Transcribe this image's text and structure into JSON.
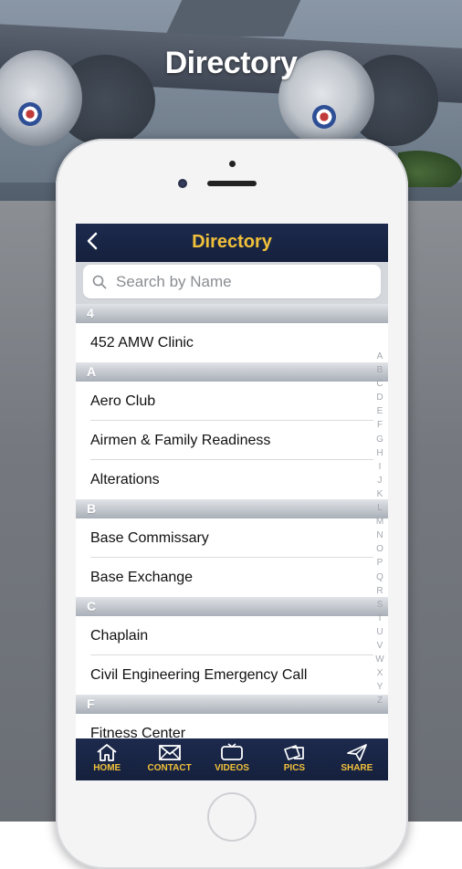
{
  "page_title": "Directory",
  "nav": {
    "back_icon": "‹",
    "title": "Directory"
  },
  "search": {
    "placeholder": "Search by Name"
  },
  "sections": [
    {
      "letter": "4",
      "items": [
        "452 AMW Clinic"
      ]
    },
    {
      "letter": "A",
      "items": [
        "Aero Club",
        "Airmen & Family Readiness",
        "Alterations"
      ]
    },
    {
      "letter": "B",
      "items": [
        "Base Commissary",
        "Base Exchange"
      ]
    },
    {
      "letter": "C",
      "items": [
        "Chaplain",
        "Civil Engineering Emergency Call"
      ]
    },
    {
      "letter": "F",
      "items": [
        "Fitness Center"
      ]
    }
  ],
  "index_letters": [
    "A",
    "B",
    "C",
    "D",
    "E",
    "F",
    "G",
    "H",
    "I",
    "J",
    "K",
    "L",
    "M",
    "N",
    "O",
    "P",
    "Q",
    "R",
    "S",
    "T",
    "U",
    "V",
    "W",
    "X",
    "Y",
    "Z"
  ],
  "tabs": [
    {
      "label": "HOME",
      "icon": "home-icon"
    },
    {
      "label": "CONTACT",
      "icon": "envelope-icon"
    },
    {
      "label": "VIDEOS",
      "icon": "tv-icon"
    },
    {
      "label": "PICS",
      "icon": "photos-icon"
    },
    {
      "label": "SHARE",
      "icon": "share-icon"
    }
  ],
  "colors": {
    "nav_bg": "#1d2a4d",
    "accent": "#f2c13a"
  }
}
